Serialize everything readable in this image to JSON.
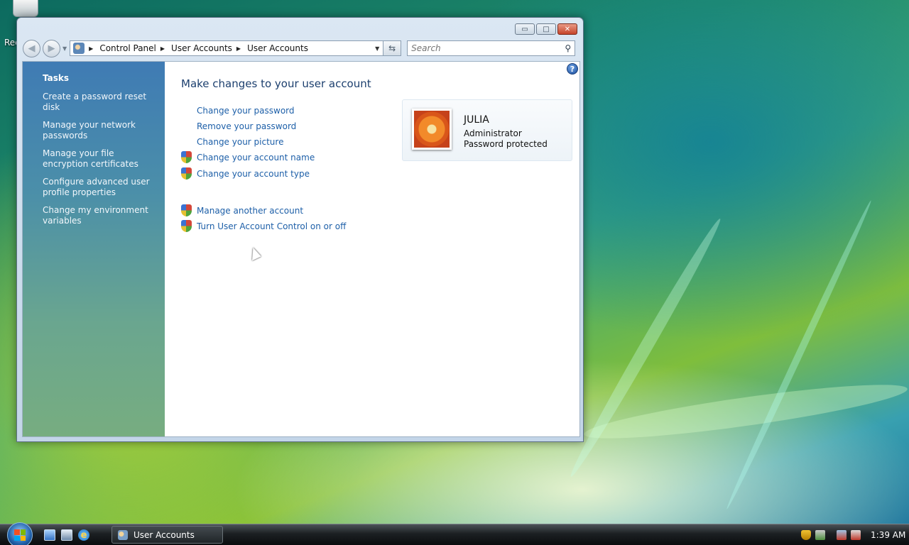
{
  "desktop": {
    "recycle_label": "Rec"
  },
  "window": {
    "buttons": {
      "minimize": "▭",
      "maximize": "□",
      "close": "✕"
    },
    "breadcrumb": [
      "Control Panel",
      "User Accounts",
      "User Accounts"
    ],
    "search_placeholder": "Search"
  },
  "sidebar": {
    "title": "Tasks",
    "items": [
      "Create a password reset disk",
      "Manage your network passwords",
      "Manage your file encryption certificates",
      "Configure advanced user profile properties",
      "Change my environment variables"
    ]
  },
  "main": {
    "heading": "Make changes to your user account",
    "links": [
      "Change your password",
      "Remove your password",
      "Change your picture",
      "Change your account name",
      "Change your account type"
    ],
    "other_links": [
      "Manage another account",
      "Turn User Account Control on or off"
    ],
    "help_label": "?"
  },
  "account": {
    "name": "JULIA",
    "role": "Administrator",
    "status": "Password protected"
  },
  "taskbar": {
    "task_label": "User Accounts",
    "clock": "1:39 AM"
  }
}
